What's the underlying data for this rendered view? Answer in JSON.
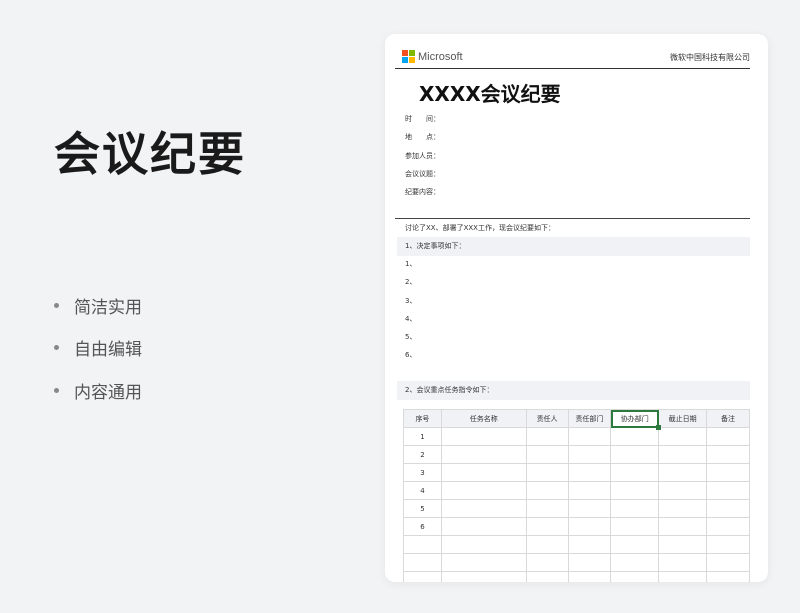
{
  "slide": {
    "title": "会议纪要",
    "features": [
      "简洁实用",
      "自由编辑",
      "内容通用"
    ]
  },
  "doc": {
    "brand": "Microsoft",
    "company": "微软中国科技有限公司",
    "title": "XXXX会议纪要",
    "fields": [
      "时　　间：",
      "地　　点：",
      "参加人员：",
      "会议议题：",
      "纪要内容："
    ],
    "intro": "讨论了XX、部署了XXX工作，现会议纪要如下：",
    "section1": "1、决定事项如下：",
    "decisions": [
      "1、",
      "2、",
      "3、",
      "4、",
      "5、",
      "6、"
    ],
    "section2": "2、会议重点任务指令如下：",
    "table": {
      "headers": [
        "序号",
        "任务名称",
        "责任人",
        "责任部门",
        "协办部门",
        "截止日期",
        "备注"
      ],
      "row_numbers": [
        "1",
        "2",
        "3",
        "4",
        "5",
        "6",
        "",
        "",
        ""
      ]
    }
  },
  "colors": {
    "logo_red": "#f25022",
    "logo_green": "#7fba00",
    "logo_blue": "#00a4ef",
    "logo_yellow": "#ffb900",
    "selection_green": "#2d7a3e"
  }
}
